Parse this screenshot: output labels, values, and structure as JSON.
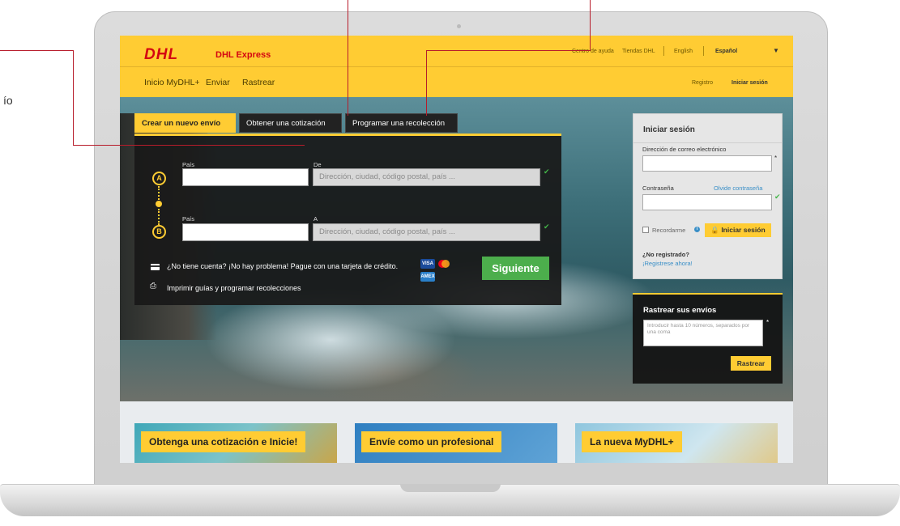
{
  "annotation": {
    "partial_label": "ío"
  },
  "header": {
    "logo_text": "DHL",
    "brand_label": "DHL Express",
    "utility_links": [
      "Centro de ayuda",
      "Tiendas DHL"
    ],
    "languages": [
      "English",
      "Español"
    ],
    "nav_items": [
      "Inicio MyDHL+",
      "Enviar",
      "Rastrear"
    ],
    "register_label": "Registro",
    "login_label": "Iniciar sesión"
  },
  "tabs": [
    "Crear un nuevo envío",
    "Obtener una cotización",
    "Programar una recolección"
  ],
  "shipment": {
    "origin": {
      "marker": "A",
      "country_label": "País",
      "address_label": "De",
      "address_placeholder": "Dirección, ciudad, código postal, país ..."
    },
    "destination": {
      "marker": "B",
      "country_label": "País",
      "address_label": "A",
      "address_placeholder": "Dirección, ciudad, código postal, país ..."
    },
    "promo_text": "¿No tiene cuenta? ¡No hay problema! Pague con una tarjeta de crédito.",
    "print_text": "Imprimir guías y programar recolecciones",
    "payment_badges": [
      "VISA",
      "AMEX"
    ],
    "next_button": "Siguiente"
  },
  "login": {
    "title": "Iniciar sesión",
    "email_label": "Dirección de correo electrónico",
    "password_label": "Contraseña",
    "forgot_link": "Olvide contraseña",
    "remember_label": "Recordarme",
    "submit_label": "Iniciar sesión",
    "not_registered": "¿No registrado?",
    "register_link": "¡Registrese ahora!"
  },
  "track": {
    "title": "Rastrear sus envíos",
    "placeholder": "Introducir hasta 10 números, separados por una coma",
    "button": "Rastrear"
  },
  "cards": [
    "Obtenga una cotización e Inicie!",
    "Envíe como un profesional",
    "La nueva MyDHL+"
  ],
  "colors": {
    "brand_yellow": "#ffcc33",
    "brand_red": "#d40511",
    "green": "#4cae4c",
    "callout_red": "#b71c2b"
  }
}
